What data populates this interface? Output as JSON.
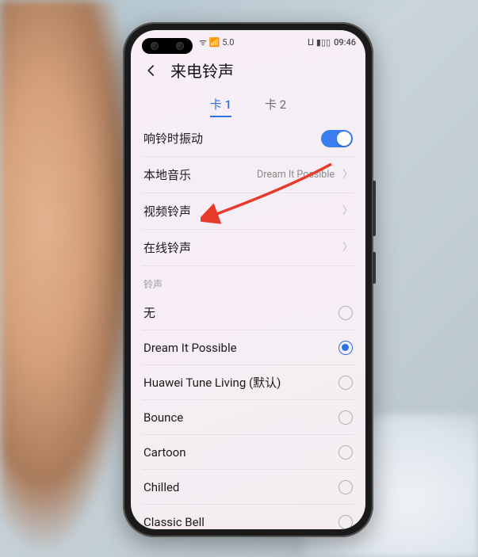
{
  "status": {
    "left_icons": "ᯤ 📶 5.0",
    "right_icons": "ⵡ ▮▯▯",
    "clock": "09:46"
  },
  "header": {
    "title": "来电铃声"
  },
  "tabs": {
    "tab1": "卡 1",
    "tab2": "卡 2"
  },
  "settings": {
    "vibrate_on_ring": {
      "label": "响铃时振动",
      "enabled": true
    },
    "local_music": {
      "label": "本地音乐",
      "value": "Dream It Possible"
    },
    "video_ringtone": {
      "label": "视频铃声"
    },
    "online_ringtone": {
      "label": "在线铃声"
    }
  },
  "ringtone_section": {
    "header": "铃声",
    "items": [
      {
        "label": "无",
        "selected": false
      },
      {
        "label": "Dream It Possible",
        "selected": true
      },
      {
        "label": "Huawei Tune Living (默认)",
        "selected": false
      },
      {
        "label": "Bounce",
        "selected": false
      },
      {
        "label": "Cartoon",
        "selected": false
      },
      {
        "label": "Chilled",
        "selected": false
      },
      {
        "label": "Classic Bell",
        "selected": false
      }
    ]
  },
  "annotation": {
    "color": "#e63a2a"
  }
}
